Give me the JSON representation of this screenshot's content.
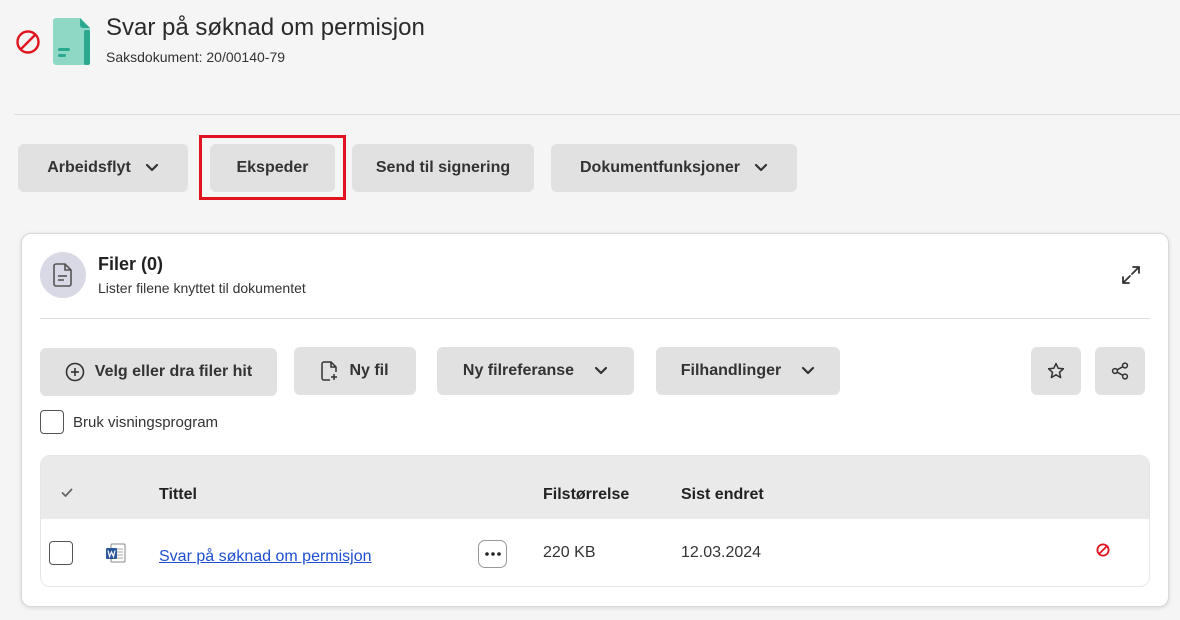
{
  "header": {
    "title": "Svar på søknad om permisjon",
    "subtitle": "Saksdokument: 20/00140-79"
  },
  "toolbar": {
    "workflow_label": "Arbeidsflyt",
    "dispatch_label": "Ekspeder",
    "send_signing_label": "Send til signering",
    "doc_functions_label": "Dokumentfunksjoner"
  },
  "files": {
    "title": "Filer (0)",
    "subtitle": "Lister filene knyttet til dokumentet",
    "select_files_label": "Velg eller dra filer hit",
    "new_file_label": "Ny fil",
    "new_file_ref_label": "Ny filreferanse",
    "file_actions_label": "Filhandlinger",
    "viewer_label": "Bruk visningsprogram",
    "columns": {
      "title": "Tittel",
      "size": "Filstørrelse",
      "modified": "Sist endret"
    },
    "rows": [
      {
        "title": "Svar på søknad om permisjon",
        "size": "220 KB",
        "modified": "12.03.2024",
        "file_icon": "word-document-icon",
        "status_icon": "blocked-icon"
      }
    ]
  },
  "colors": {
    "accent_red": "#e0141e",
    "teal": "#2aa990",
    "link": "#1d4fd0"
  }
}
